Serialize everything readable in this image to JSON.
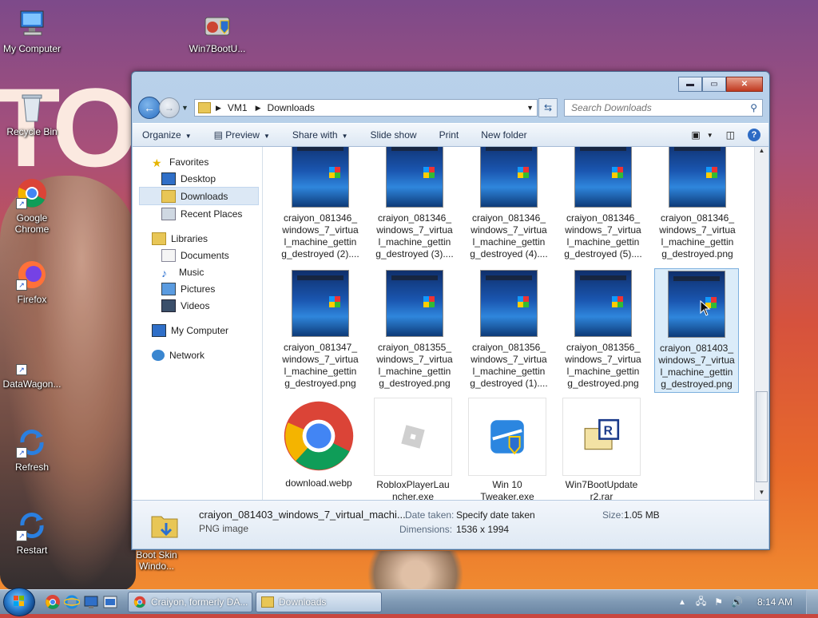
{
  "desktop": {
    "wallpaper_text": "TOR",
    "icons": [
      {
        "label": "My Computer"
      },
      {
        "label": "Win7BootU..."
      },
      {
        "label": "Recycle Bin"
      },
      {
        "label": "Google Chrome"
      },
      {
        "label": "Firefox"
      },
      {
        "label": "DataWagon..."
      },
      {
        "label": "Refresh"
      },
      {
        "label": "Restart"
      },
      {
        "label": "Boot Skin Windo..."
      }
    ]
  },
  "window": {
    "caption_buttons": {
      "minimize": "▬",
      "maximize": "▭",
      "close": "✕"
    },
    "address": {
      "crumbs": [
        "VM1",
        "Downloads"
      ]
    },
    "search": {
      "placeholder": "Search Downloads"
    },
    "toolbar": {
      "organize": "Organize",
      "preview": "Preview",
      "share_with": "Share with",
      "slide_show": "Slide show",
      "print": "Print",
      "new_folder": "New folder"
    },
    "nav": {
      "favorites": "Favorites",
      "desktop": "Desktop",
      "downloads": "Downloads",
      "recent_places": "Recent Places",
      "libraries": "Libraries",
      "documents": "Documents",
      "music": "Music",
      "pictures": "Pictures",
      "videos": "Videos",
      "my_computer": "My Computer",
      "network": "Network"
    },
    "files": [
      {
        "name": "craiyon_081346_\nwindows_7_virtua\nl_machine_gettin\ng_destroyed (2)...."
      },
      {
        "name": "craiyon_081346_\nwindows_7_virtua\nl_machine_gettin\ng_destroyed (3)...."
      },
      {
        "name": "craiyon_081346_\nwindows_7_virtua\nl_machine_gettin\ng_destroyed (4)...."
      },
      {
        "name": "craiyon_081346_\nwindows_7_virtua\nl_machine_gettin\ng_destroyed (5)...."
      },
      {
        "name": "craiyon_081346_\nwindows_7_virtua\nl_machine_gettin\ng_destroyed.png"
      },
      {
        "name": "craiyon_081347_\nwindows_7_virtua\nl_machine_gettin\ng_destroyed.png"
      },
      {
        "name": "craiyon_081355_\nwindows_7_virtua\nl_machine_gettin\ng_destroyed.png"
      },
      {
        "name": "craiyon_081356_\nwindows_7_virtua\nl_machine_gettin\ng_destroyed (1)...."
      },
      {
        "name": "craiyon_081356_\nwindows_7_virtua\nl_machine_gettin\ng_destroyed.png"
      },
      {
        "name": "craiyon_081403_\nwindows_7_virtua\nl_machine_gettin\ng_destroyed.png",
        "selected": true
      },
      {
        "name": "download.webp"
      },
      {
        "name": "RobloxPlayerLau\nncher.exe"
      },
      {
        "name": "Win 10\nTweaker.exe"
      },
      {
        "name": "Win7BootUpdate\nr2.rar"
      }
    ],
    "details": {
      "filename": "craiyon_081403_windows_7_virtual_machi...",
      "filetype": "PNG image",
      "date_taken_label": "Date taken:",
      "date_taken_value": "Specify date taken",
      "dimensions_label": "Dimensions:",
      "dimensions_value": "1536 x 1994",
      "size_label": "Size:",
      "size_value": "1.05 MB"
    }
  },
  "taskbar": {
    "buttons": [
      {
        "label": "Craiyon, formerly DA..."
      },
      {
        "label": "Downloads"
      }
    ],
    "clock": "8:14 AM"
  },
  "colors": {
    "window_frame": "#b9d1ea",
    "selection": "#99c9ef",
    "taskbar": "#7f99b4"
  }
}
